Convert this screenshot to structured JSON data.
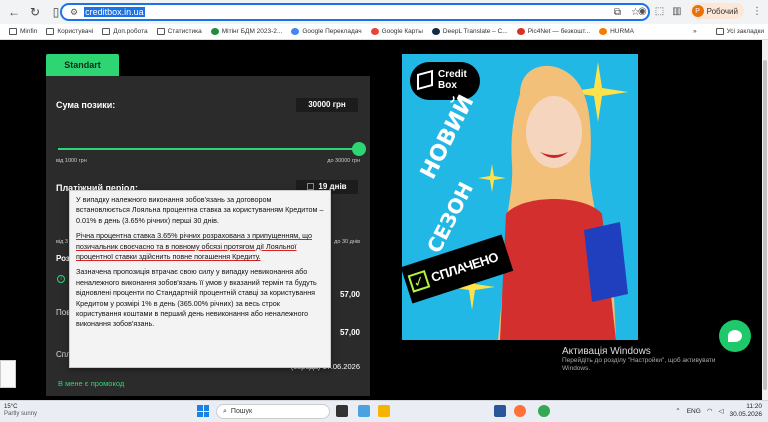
{
  "browser": {
    "url": "creditbox.in.ua",
    "profile_label": "Робочий",
    "profile_initial": "Р",
    "bookmarks": [
      "Minfin",
      "Користувачі",
      "Доп.робота",
      "Статистика",
      "Мітінг БДМ 2023-2...",
      "Google Перекладач",
      "Google Карты",
      "DeepL Translate – C...",
      "Pic4Net — безкошт...",
      "HURMA"
    ],
    "all_bookmarks_label": "Усі закладки",
    "more_label": "»"
  },
  "calculator": {
    "tab_label": "Standart",
    "loan_label": "Сума позики:",
    "loan_value": "30000 грн",
    "loan_min": "від 1000 грн",
    "loan_max": "до 30000 грн",
    "period_label": "Платіжний період:",
    "period_value": "19 днів",
    "period_min": "від 3",
    "period_max": "до 30 днів",
    "row1_label": "Роз",
    "row2_value": "57,00",
    "row3_label": "Пов",
    "row3_value": "57,00",
    "row4_label": "Спл",
    "row4_value": "(середа) 17.06.2026",
    "promo_label": "В мене є промокод"
  },
  "tooltip": {
    "p1": "У випадку належного виконання зобов'язань за договором встановлюється Лояльна процентна ставка за користуванням Кредитом – 0.01% в день (3.65% річних) перші 30 днів.",
    "p2": "Річна процентна ставка 3.65% річних розрахована з припущенням, що позичальник своєчасно та в повному обсязі протягом дії Лояльної процентної ставки здійснить повне погашення Кредиту.",
    "p3": "Зазначена пропозиція втрачає свою силу у випадку невиконання або неналежного виконання зобов'язань її умов у вказаний термін та будуть відновлені проценти по Стандартній процентній ставці за користування Кредитом у розмірі 1% в день (365.00% річних) за весь строк користування коштами в перший день невиконання або неналежного виконання зобов'язань."
  },
  "banner": {
    "logo_line1": "Credit",
    "logo_line2": "Box",
    "word1": "НОВИЙ",
    "word2": "СЕЗОН",
    "paid_label": "СПЛАЧЕНО",
    "colors": {
      "bg": "#22b8e6",
      "accent": "#b7f23a"
    }
  },
  "windows_activation": {
    "title": "Активація Windows",
    "subtitle": "Перейдіть до розділу \"Настройки\", щоб активувати Windows."
  },
  "taskbar": {
    "temp": "15°C",
    "weather": "Partly sunny",
    "search_placeholder": "Пошук",
    "lang": "ENG",
    "time": "11:20",
    "date": "30.05.2026"
  },
  "accent_color": "#2ed573"
}
